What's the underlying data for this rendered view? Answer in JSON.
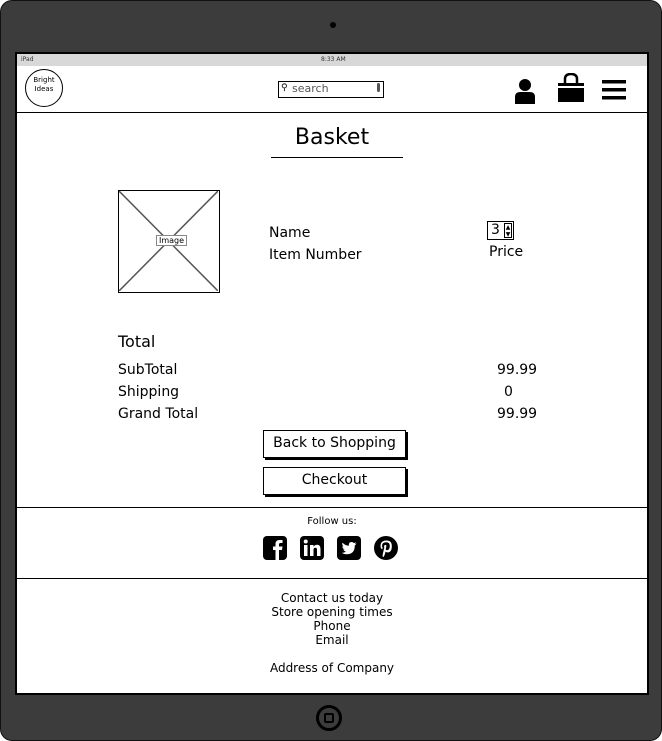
{
  "device": {
    "status_left": "iPad",
    "status_time": "8:33 AM"
  },
  "header": {
    "logo_line1": "Bright",
    "logo_line2": "Ideas",
    "search_placeholder": "search",
    "icons": [
      "user-icon",
      "shopping-bag-icon",
      "hamburger-menu-icon"
    ]
  },
  "page": {
    "title": "Basket"
  },
  "item": {
    "image_label": "Image",
    "name": "Name",
    "number": "Item Number",
    "quantity": "3",
    "price": "Price"
  },
  "totals": {
    "heading": "Total",
    "rows": [
      {
        "label": "SubTotal",
        "value": "99.99"
      },
      {
        "label": "Shipping",
        "value": "0"
      },
      {
        "label": "Grand Total",
        "value": "99.99"
      }
    ]
  },
  "buttons": {
    "back": "Back to Shopping",
    "checkout": "Checkout"
  },
  "footer": {
    "follow": "Follow us:",
    "social": [
      "facebook-icon",
      "linkedin-icon",
      "twitter-icon",
      "pinterest-icon"
    ],
    "contact": "Contact us today",
    "hours": "Store opening times",
    "phone": "Phone",
    "email": "Email",
    "address": "Address of Company"
  }
}
